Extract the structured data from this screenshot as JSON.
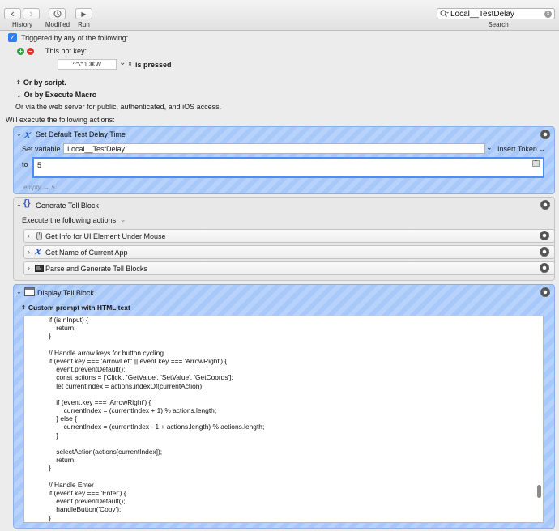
{
  "toolbar": {
    "back_glyph": "‹",
    "forward_glyph": "›",
    "history_label": "History",
    "modified_label": "Modified",
    "run_label": "Run",
    "run_glyph": "▶",
    "search_value": "Local__TestDelay",
    "search_label": "Search"
  },
  "trigger": {
    "checked_glyph": "✓",
    "triggered_label": "Triggered by any of the following:",
    "plus_glyph": "+",
    "minus_glyph": "−",
    "hotkey_label": "This hot key:",
    "hotkey_value": "^⌥⇧⌘W",
    "hotkey_dropdown_glyph": "⌄",
    "updown_glyph": "⌃⌄",
    "pressed_label": "is pressed",
    "or_script_label": "Or by script.",
    "or_execute_label": "Or by Execute Macro",
    "web_server_text": "Or via the web server for public, authenticated, and iOS access.",
    "will_execute_label": "Will execute the following actions:"
  },
  "action_set_variable": {
    "title": "Set Default Test Delay Time",
    "set_variable_label": "Set variable",
    "variable_name": "Local__TestDelay",
    "insert_token_label": "Insert Token",
    "to_label": "to",
    "value": "5",
    "t_badge": "T",
    "preview_text": "empty → 5"
  },
  "action_tell_block": {
    "title": "Generate Tell Block",
    "execute_label": "Execute the following actions",
    "sub_actions": [
      {
        "label": "Get Info for UI Element Under Mouse"
      },
      {
        "label": "Get Name of Current App"
      },
      {
        "label": "Parse and Generate Tell Blocks"
      }
    ]
  },
  "action_display": {
    "title": "Display Tell Block",
    "prompt_label": "Custom prompt with HTML text",
    "code_lines": [
      "if (isInInput) {",
      "    return;",
      "}",
      "",
      "// Handle arrow keys for button cycling",
      "if (event.key === 'ArrowLeft' || event.key === 'ArrowRight') {",
      "    event.preventDefault();",
      "    const actions = ['Click', 'GetValue', 'SetValue', 'GetCoords'];",
      "    let currentIndex = actions.indexOf(currentAction);",
      "",
      "    if (event.key === 'ArrowRight') {",
      "        currentIndex = (currentIndex + 1) % actions.length;",
      "    } else {",
      "        currentIndex = (currentIndex - 1 + actions.length) % actions.length;",
      "    }",
      "",
      "    selectAction(actions[currentIndex]);",
      "    return;",
      "}",
      "",
      "// Handle Enter",
      "if (event.key === 'Enter') {",
      "    event.preventDefault();",
      "    handleButton('Copy');",
      "}"
    ]
  },
  "colors": {
    "accent": "#2f7cf6",
    "selected_stripe_a": "#b8d3fb",
    "selected_stripe_b": "#a7c8f8",
    "add_green": "#2ea043",
    "remove_red": "#d9342b"
  }
}
